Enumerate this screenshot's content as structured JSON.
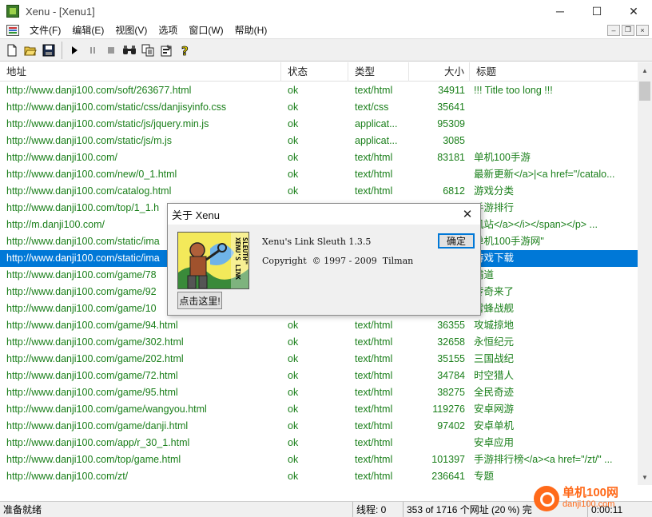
{
  "window": {
    "title": "Xenu - [Xenu1]",
    "controls": {
      "minimize": "─",
      "maximize": "☐",
      "close": "✕"
    }
  },
  "menu": {
    "items": [
      "文件(F)",
      "编辑(E)",
      "视图(V)",
      "选项",
      "窗口(W)",
      "帮助(H)"
    ],
    "mdi_controls": {
      "minimize": "–",
      "restore": "❐",
      "close": "×"
    }
  },
  "toolbar": {
    "buttons": [
      "new-icon",
      "open-icon",
      "save-icon",
      "play-icon",
      "pause-icon",
      "stop-icon",
      "find-icon",
      "copy-icon",
      "properties-icon",
      "help-icon"
    ]
  },
  "list": {
    "headers": {
      "url": "地址",
      "status": "状态",
      "type": "类型",
      "size": "大小",
      "title": "标题"
    },
    "rows": [
      {
        "url": "http://www.danji100.com/soft/263677.html",
        "status": "ok",
        "type": "text/html",
        "size": "34911",
        "title": "!!! Title too long !!!"
      },
      {
        "url": "http://www.danji100.com/static/css/danjisyinfo.css",
        "status": "ok",
        "type": "text/css",
        "size": "35641",
        "title": ""
      },
      {
        "url": "http://www.danji100.com/static/js/jquery.min.js",
        "status": "ok",
        "type": "applicat...",
        "size": "95309",
        "title": ""
      },
      {
        "url": "http://www.danji100.com/static/js/m.js",
        "status": "ok",
        "type": "applicat...",
        "size": "3085",
        "title": ""
      },
      {
        "url": "http://www.danji100.com/",
        "status": "ok",
        "type": "text/html",
        "size": "83181",
        "title": "单机100手游"
      },
      {
        "url": "http://www.danji100.com/new/0_1.html",
        "status": "ok",
        "type": "text/html",
        "size": "",
        "title": "最新更新</a>|<a href=\"/catalo..."
      },
      {
        "url": "http://www.danji100.com/catalog.html",
        "status": "ok",
        "type": "text/html",
        "size": "6812",
        "title": "游戏分类"
      },
      {
        "url": "http://www.danji100.com/top/1_1.h",
        "status": "",
        "type": "",
        "size": "",
        "title": "手游排行"
      },
      {
        "url": "http://m.danji100.com/",
        "status": "",
        "type": "",
        "size": "",
        "title": "机站</a></i></span></p> ..."
      },
      {
        "url": "http://www.danji100.com/static/ima",
        "status": "",
        "type": "",
        "size": "",
        "title": "单机100手游网\""
      },
      {
        "url": "http://www.danji100.com/static/ima",
        "status": "",
        "type": "",
        "size": "",
        "title": "游戏下载"
      },
      {
        "url": "http://www.danji100.com/game/78",
        "status": "",
        "type": "",
        "size": "",
        "title": "霸道"
      },
      {
        "url": "http://www.danji100.com/game/92",
        "status": "",
        "type": "",
        "size": "",
        "title": "传奇来了"
      },
      {
        "url": "http://www.danji100.com/game/10",
        "status": "",
        "type": "",
        "size": "",
        "title": "雷蜂战舰"
      },
      {
        "url": "http://www.danji100.com/game/94.html",
        "status": "ok",
        "type": "text/html",
        "size": "36355",
        "title": "攻城掠地"
      },
      {
        "url": "http://www.danji100.com/game/302.html",
        "status": "ok",
        "type": "text/html",
        "size": "32658",
        "title": "永恒纪元"
      },
      {
        "url": "http://www.danji100.com/game/202.html",
        "status": "ok",
        "type": "text/html",
        "size": "35155",
        "title": "三国战纪"
      },
      {
        "url": "http://www.danji100.com/game/72.html",
        "status": "ok",
        "type": "text/html",
        "size": "34784",
        "title": "时空猎人"
      },
      {
        "url": "http://www.danji100.com/game/95.html",
        "status": "ok",
        "type": "text/html",
        "size": "38275",
        "title": "全民奇迹"
      },
      {
        "url": "http://www.danji100.com/game/wangyou.html",
        "status": "ok",
        "type": "text/html",
        "size": "119276",
        "title": "安卓网游"
      },
      {
        "url": "http://www.danji100.com/game/danji.html",
        "status": "ok",
        "type": "text/html",
        "size": "97402",
        "title": "安卓单机"
      },
      {
        "url": "http://www.danji100.com/app/r_30_1.html",
        "status": "ok",
        "type": "text/html",
        "size": "",
        "title": "安卓应用"
      },
      {
        "url": "http://www.danji100.com/top/game.html",
        "status": "ok",
        "type": "text/html",
        "size": "101397",
        "title": "手游排行榜</a><a href=\"/zt/\" ..."
      },
      {
        "url": "http://www.danji100.com/zt/",
        "status": "ok",
        "type": "text/html",
        "size": "236641",
        "title": "专题"
      }
    ],
    "selected_index": 10
  },
  "dialog": {
    "title": "关于 Xenu",
    "close": "✕",
    "line1": "Xenu's Link Sleuth 1.3.5",
    "line2": "Copyright  © 1997 - 2009  Tilman",
    "ok_label": "确定",
    "click_label": "点击这里!",
    "logo_text": "XENU'S LINK SLEUTH™"
  },
  "status": {
    "ready": "准备就绪",
    "threads": "线程: 0",
    "progress": "353 of 1716 个网址 (20 %) 完",
    "time": "0:00:11"
  },
  "watermark": {
    "main": "单机100网",
    "sub": "danji100.com"
  },
  "colors": {
    "link_green": "#1a7f1a",
    "selection": "#0078d7",
    "accent_orange": "#ff6a1a"
  }
}
